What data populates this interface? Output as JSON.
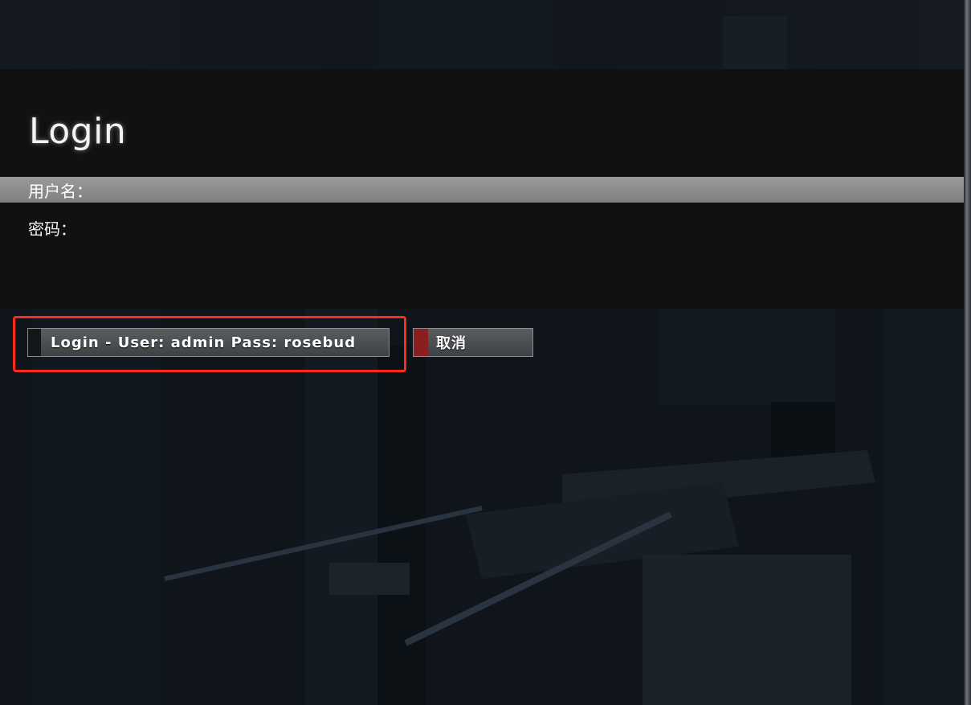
{
  "login_screen": {
    "title": "Login",
    "username_label": "用户名：",
    "username_value": "",
    "password_label": "密码：",
    "password_value": "",
    "login_button_label": "Login - User: admin Pass: rosebud",
    "cancel_button_label": "取消"
  },
  "colors": {
    "panel_background": "#111111",
    "selected_row": "#8c8c8c",
    "cancel_accent": "#8b1e1e",
    "highlight_border": "#ff2a1a"
  },
  "icons": [
    "cancel-accent-marker",
    "login-accent-marker"
  ]
}
